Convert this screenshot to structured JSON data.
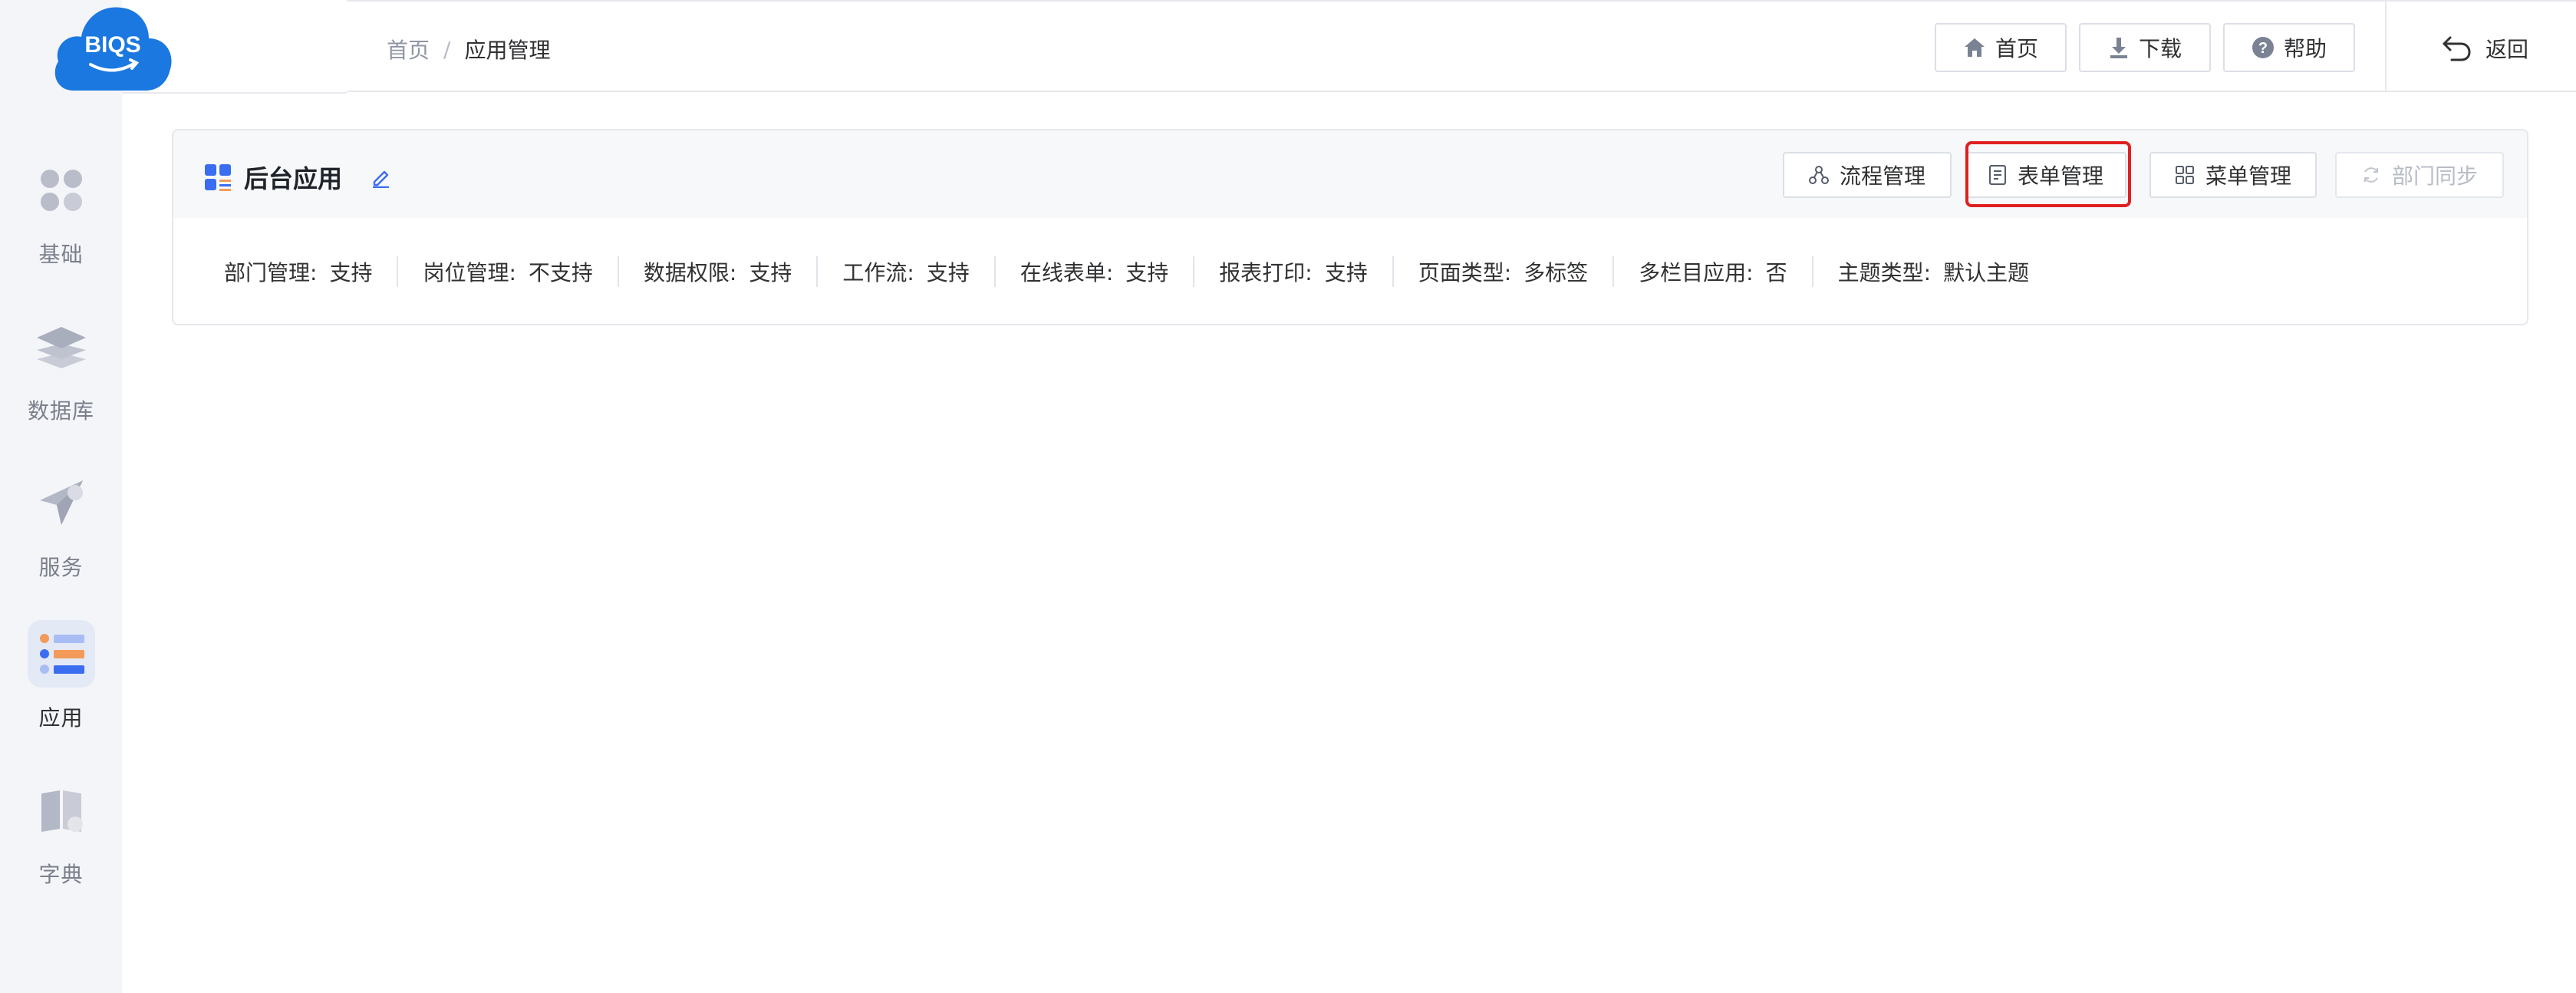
{
  "logo": {
    "text": "BIQS",
    "color": "#1a78e0"
  },
  "sidebar": {
    "items": [
      {
        "label": "基础",
        "icon": "apps-grid-icon",
        "active": false
      },
      {
        "label": "数据库",
        "icon": "layers-icon",
        "active": false
      },
      {
        "label": "服务",
        "icon": "paper-plane-icon",
        "active": false
      },
      {
        "label": "应用",
        "icon": "app-list-icon",
        "active": true
      },
      {
        "label": "字典",
        "icon": "book-icon",
        "active": false
      }
    ]
  },
  "breadcrumb": {
    "home": "首页",
    "separator": "/",
    "current": "应用管理"
  },
  "header": {
    "home_label": "首页",
    "download_label": "下载",
    "help_label": "帮助",
    "back_label": "返回"
  },
  "card": {
    "title": "后台应用",
    "actions": {
      "workflow": "流程管理",
      "form": "表单管理",
      "menu": "菜单管理",
      "dept_sync": "部门同步"
    },
    "properties": [
      {
        "key": "部门管理:",
        "value": "支持"
      },
      {
        "key": "岗位管理:",
        "value": "不支持"
      },
      {
        "key": "数据权限:",
        "value": "支持"
      },
      {
        "key": "工作流:",
        "value": "支持"
      },
      {
        "key": "在线表单:",
        "value": "支持"
      },
      {
        "key": "报表打印:",
        "value": "支持"
      },
      {
        "key": "页面类型:",
        "value": "多标签"
      },
      {
        "key": "多栏目应用:",
        "value": "否"
      },
      {
        "key": "主题类型:",
        "value": "默认主题"
      }
    ]
  },
  "colors": {
    "accent": "#3a6df0",
    "highlight": "#e02020",
    "sidebar_bg": "#f4f5f8"
  }
}
